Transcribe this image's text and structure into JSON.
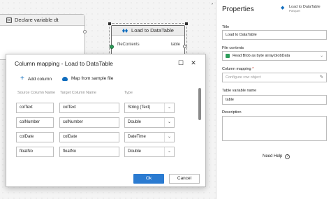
{
  "canvas": {
    "declare_node": {
      "title": "Declare variable dt"
    },
    "load_node": {
      "title": "Load to DataTable",
      "input_port": "fileContents",
      "output_port": "table"
    }
  },
  "dialog": {
    "title": "Column mapping - Load to DataTable",
    "add_column": "Add column",
    "map_from_sample": "Map from sample file",
    "headers": {
      "source": "Source Column Name",
      "target": "Target Column Name",
      "type": "Type"
    },
    "rows": [
      {
        "source": "colText",
        "target": "colText",
        "type": "String (Text)"
      },
      {
        "source": "colNumber",
        "target": "colNumber",
        "type": "Double"
      },
      {
        "source": "colDate",
        "target": "colDate",
        "type": "DateTime"
      },
      {
        "source": "floatNo",
        "target": "floatNo",
        "type": "Double"
      }
    ],
    "ok": "Ok",
    "cancel": "Cancel"
  },
  "properties": {
    "header": "Properties",
    "activity_name": "Load to DataTable",
    "activity_sub": "Parquet",
    "title_label": "Title",
    "title_value": "Load to DataTable",
    "file_contents_label": "File contents",
    "file_contents_value": "Read Blob as byte array.blobData",
    "column_mapping_label": "Column mapping",
    "column_mapping_required": "*",
    "column_mapping_placeholder": "Configure row object",
    "table_variable_label": "Table variable name",
    "table_variable_value": "table",
    "description_label": "Description",
    "need_help": "Need Help"
  },
  "colors": {
    "accent": "#2b7bd1",
    "green_port": "#2e9d5b"
  }
}
